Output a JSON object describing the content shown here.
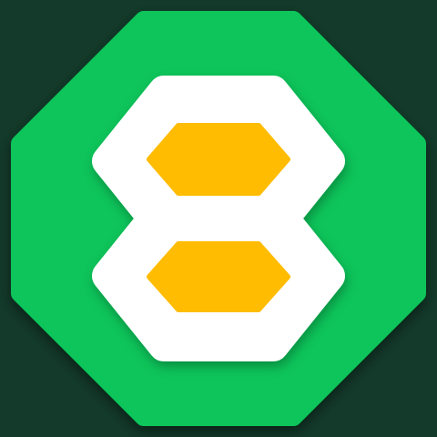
{
  "icon": {
    "name": "eight-segment-app-icon",
    "colors": {
      "background": "#133A2A",
      "octagon": "#08C55A",
      "octagon_shadow": "#0A2A1C",
      "glyph": "#FFFFFF",
      "cells": "#FFBC00",
      "cell_edge": "#E6A300"
    }
  }
}
